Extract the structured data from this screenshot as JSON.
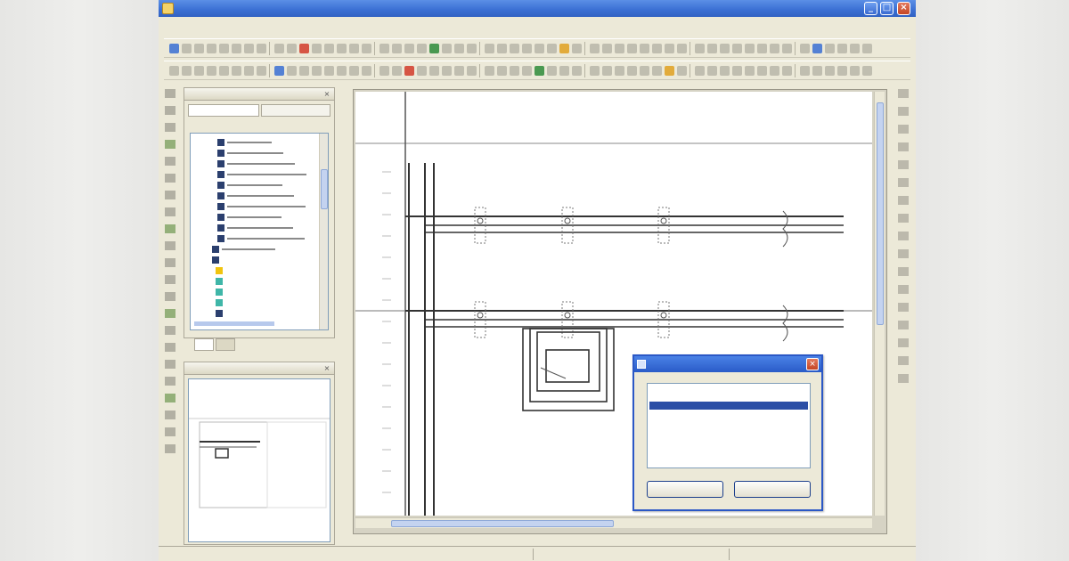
{
  "window": {
    "title": "",
    "minimize_label": "_",
    "maximize_label": "□",
    "close_label": "×"
  },
  "menu": {
    "items": []
  },
  "toolbar": {
    "rows": 2,
    "accent_colors": [
      "#3a6fd3",
      "#d23b2a",
      "#2e8b3a",
      "#e0a020",
      "#7a4bb0"
    ]
  },
  "explorer_panel": {
    "title": "",
    "close_label": "×",
    "tab_labels": [
      "",
      ""
    ],
    "tree": {
      "selected_icon": "folder-yellow-icon",
      "items": [
        {
          "icon": "component-icon"
        },
        {
          "icon": "component-icon"
        },
        {
          "icon": "component-icon"
        },
        {
          "icon": "component-icon"
        },
        {
          "icon": "component-icon"
        },
        {
          "icon": "component-icon"
        },
        {
          "icon": "component-icon"
        },
        {
          "icon": "component-icon"
        },
        {
          "icon": "component-icon"
        },
        {
          "icon": "component-icon"
        },
        {
          "icon": "component-icon"
        },
        {
          "icon": "folder-icon"
        },
        {
          "icon": "folder-yellow-icon"
        },
        {
          "icon": "component-teal-icon"
        },
        {
          "icon": "component-teal-icon"
        },
        {
          "icon": "component-teal-icon"
        },
        {
          "icon": "component-icon"
        }
      ]
    },
    "bottom_tabs": [
      "",
      ""
    ]
  },
  "preview_panel": {
    "title": "",
    "close_label": "×"
  },
  "drawing": {
    "type": "electrical-schematic",
    "line_color": "#333333",
    "row_1_labels": [
      "",
      "",
      "",
      "",
      ""
    ],
    "row_2_labels": [
      "",
      "",
      "",
      "",
      ""
    ]
  },
  "dialog": {
    "title": "",
    "close_label": "×",
    "list_items": [
      "",
      "",
      ""
    ],
    "selected_index": 1,
    "ok_label": "",
    "cancel_label": ""
  },
  "statusbar": {
    "fields": [
      "",
      "",
      "",
      ""
    ]
  }
}
